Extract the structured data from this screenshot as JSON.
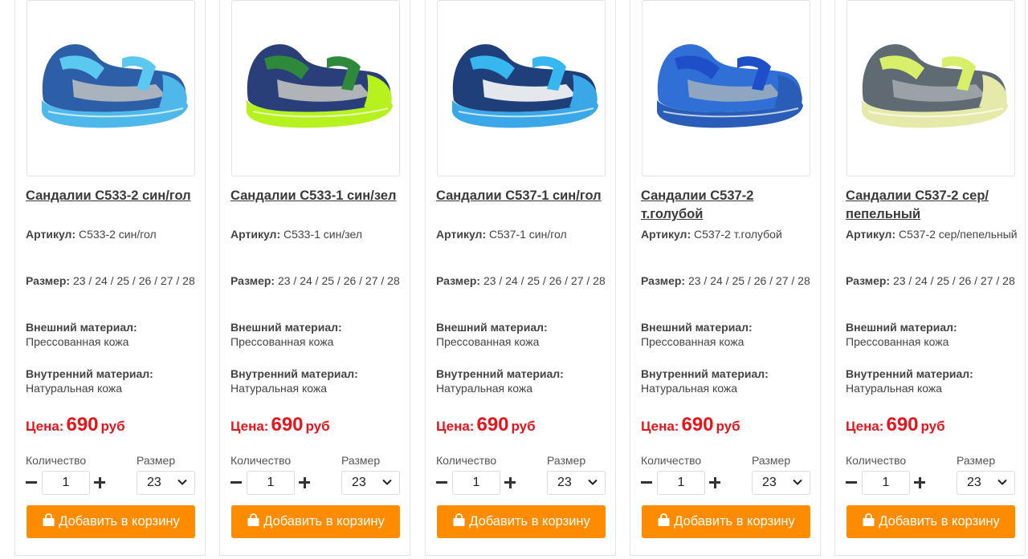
{
  "labels": {
    "article": "Артикул:",
    "size": "Размер:",
    "outer": "Внешний материал:",
    "inner": "Внутренний материал:",
    "price": "Цена:",
    "currency": "руб",
    "quantity": "Количество",
    "size_select": "Размер",
    "add_to_cart": "Добавить в корзину"
  },
  "colors": {
    "accent": "#ff8c00",
    "price": "#e8141a"
  },
  "products": [
    {
      "title": "Сандалии C533-2 син/гол",
      "article": "C533-2 син/гол",
      "sizes": "23 / 24 / 25 / 26 / 27 / 28",
      "outer_material": "Прессованная кожа",
      "inner_material": "Натуральная кожа",
      "price": "690",
      "quantity": "1",
      "selected_size": "23",
      "image_colors": {
        "main": "#2d5fa8",
        "accent": "#5bc8f0",
        "sole": "#4fb8ea",
        "side": "#a9b3bd"
      }
    },
    {
      "title": "Сандалии C533-1 син/зел",
      "article": "C533-1 син/зел",
      "sizes": "23 / 24 / 25 / 26 / 27 / 28",
      "outer_material": "Прессованная кожа",
      "inner_material": "Натуральная кожа",
      "price": "690",
      "quantity": "1",
      "selected_size": "23",
      "image_colors": {
        "main": "#2a3f7a",
        "accent": "#2e8a3a",
        "sole": "#b8f21e",
        "side": "#b0b4b8"
      }
    },
    {
      "title": "Сандалии C537-1 син/гол",
      "article": "C537-1 син/гол",
      "sizes": "23 / 24 / 25 / 26 / 27 / 28",
      "outer_material": "Прессованная кожа",
      "inner_material": "Натуральная кожа",
      "price": "690",
      "quantity": "1",
      "selected_size": "23",
      "image_colors": {
        "main": "#1e3f7a",
        "accent": "#36b7ef",
        "sole": "#3aa8e8",
        "side": "#e4e8ec"
      }
    },
    {
      "title": "Сандалии C537-2 т.голубой",
      "article": "C537-2 т.голубой",
      "sizes": "23 / 24 / 25 / 26 / 27 / 28",
      "outer_material": "Прессованная кожа",
      "inner_material": "Натуральная кожа",
      "price": "690",
      "quantity": "1",
      "selected_size": "23",
      "image_colors": {
        "main": "#2f6fd6",
        "accent": "#1f4fc8",
        "sole": "#2a5db8",
        "side": "#8fa6c0"
      }
    },
    {
      "title": "Сандалии C537-2 сер/пепельный",
      "article": "C537-2 сер/пепельный",
      "sizes": "23 / 24 / 25 / 26 / 27 / 28",
      "outer_material": "Прессованная кожа",
      "inner_material": "Натуральная кожа",
      "price": "690",
      "quantity": "1",
      "selected_size": "23",
      "image_colors": {
        "main": "#5f6a72",
        "accent": "#d8ef6a",
        "sole": "#e6eaa8",
        "side": "#9aa2a8"
      }
    }
  ]
}
